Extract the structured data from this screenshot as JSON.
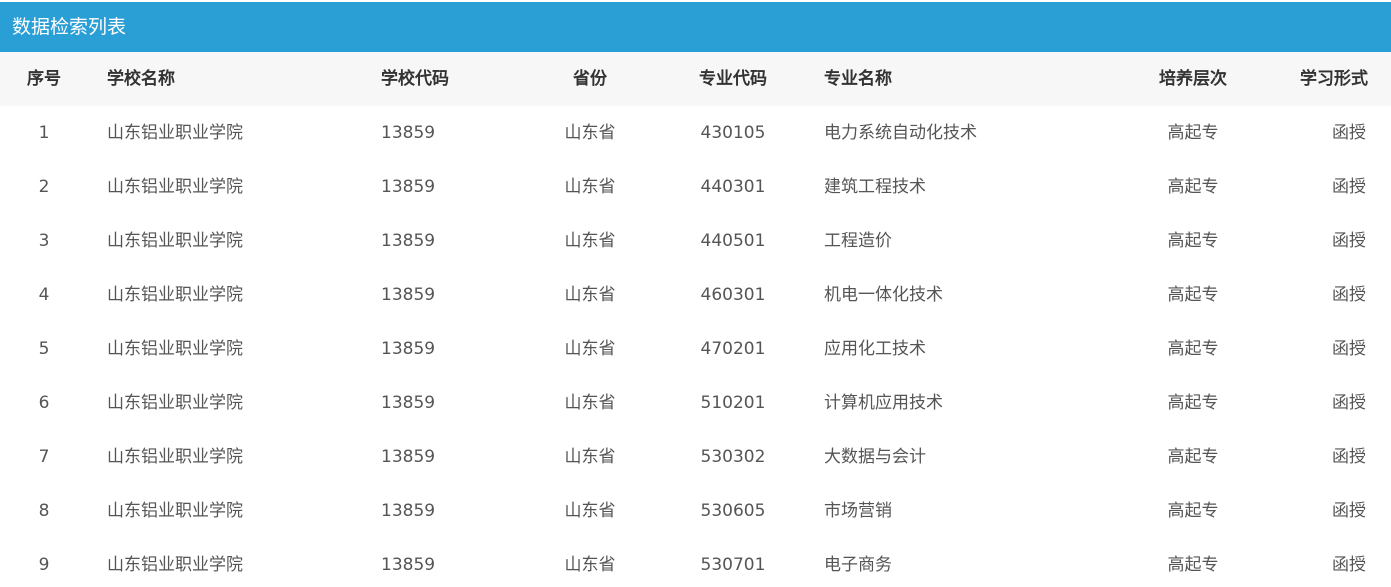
{
  "panel": {
    "title": "数据检索列表"
  },
  "table": {
    "headers": {
      "seq": "序号",
      "school_name": "学校名称",
      "school_code": "学校代码",
      "province": "省份",
      "major_code": "专业代码",
      "major_name": "专业名称",
      "level": "培养层次",
      "form": "学习形式"
    },
    "rows": [
      {
        "seq": "1",
        "school_name": "山东铝业职业学院",
        "school_code": "13859",
        "province": "山东省",
        "major_code": "430105",
        "major_name": "电力系统自动化技术",
        "level": "高起专",
        "form": "函授"
      },
      {
        "seq": "2",
        "school_name": "山东铝业职业学院",
        "school_code": "13859",
        "province": "山东省",
        "major_code": "440301",
        "major_name": "建筑工程技术",
        "level": "高起专",
        "form": "函授"
      },
      {
        "seq": "3",
        "school_name": "山东铝业职业学院",
        "school_code": "13859",
        "province": "山东省",
        "major_code": "440501",
        "major_name": "工程造价",
        "level": "高起专",
        "form": "函授"
      },
      {
        "seq": "4",
        "school_name": "山东铝业职业学院",
        "school_code": "13859",
        "province": "山东省",
        "major_code": "460301",
        "major_name": "机电一体化技术",
        "level": "高起专",
        "form": "函授"
      },
      {
        "seq": "5",
        "school_name": "山东铝业职业学院",
        "school_code": "13859",
        "province": "山东省",
        "major_code": "470201",
        "major_name": "应用化工技术",
        "level": "高起专",
        "form": "函授"
      },
      {
        "seq": "6",
        "school_name": "山东铝业职业学院",
        "school_code": "13859",
        "province": "山东省",
        "major_code": "510201",
        "major_name": "计算机应用技术",
        "level": "高起专",
        "form": "函授"
      },
      {
        "seq": "7",
        "school_name": "山东铝业职业学院",
        "school_code": "13859",
        "province": "山东省",
        "major_code": "530302",
        "major_name": "大数据与会计",
        "level": "高起专",
        "form": "函授"
      },
      {
        "seq": "8",
        "school_name": "山东铝业职业学院",
        "school_code": "13859",
        "province": "山东省",
        "major_code": "530605",
        "major_name": "市场营销",
        "level": "高起专",
        "form": "函授"
      },
      {
        "seq": "9",
        "school_name": "山东铝业职业学院",
        "school_code": "13859",
        "province": "山东省",
        "major_code": "530701",
        "major_name": "电子商务",
        "level": "高起专",
        "form": "函授"
      }
    ]
  }
}
